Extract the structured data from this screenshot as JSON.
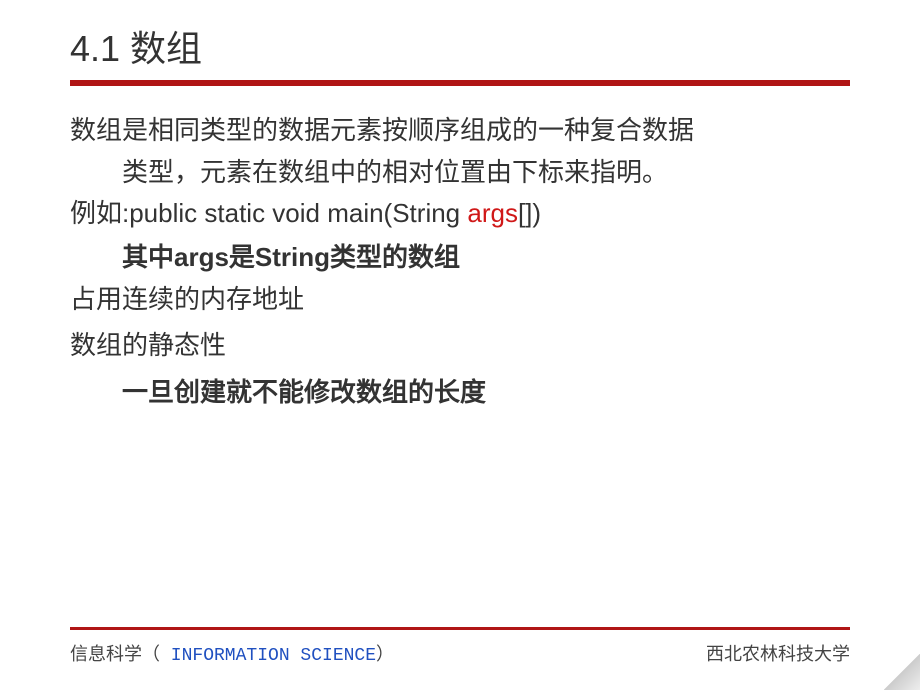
{
  "title": "4.1 数组",
  "intro_line1": "数组是相同类型的数据元素按顺序组成的一种复合数据",
  "intro_line2": "类型，元素在数组中的相对位置由下标来指明。",
  "example_prefix": "例如:public static void main(String ",
  "example_args": "args",
  "example_suffix": "[])",
  "args_desc": "其中args是String类型的数组",
  "memory_line": "占用连续的内存地址",
  "static_line": "数组的静态性",
  "static_desc": "一旦创建就不能修改数组的长度",
  "footer_left_cn": "信息科学（",
  "footer_left_en": " INFORMATION SCIENCE",
  "footer_left_close": "）",
  "footer_right": "西北农林科技大学"
}
